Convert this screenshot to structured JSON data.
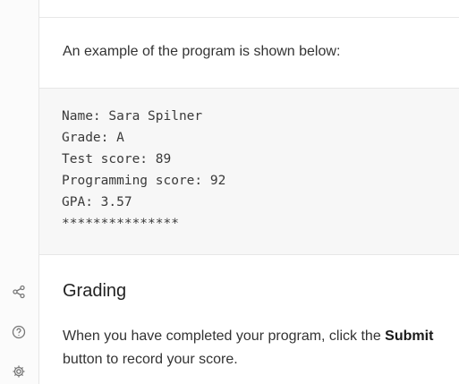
{
  "rail": {
    "icons": [
      {
        "name": "share-icon"
      },
      {
        "name": "help-icon"
      },
      {
        "name": "settings-icon"
      }
    ]
  },
  "intro": {
    "text": "An example of the program is shown below:"
  },
  "code": {
    "lines": [
      "Name: Sara Spilner",
      "Grade: A",
      "Test score: 89",
      "Programming score: 92",
      "GPA: 3.57",
      "***************"
    ]
  },
  "grading": {
    "title": "Grading",
    "text_before": "When you have completed your program, click the ",
    "submit_word": "Submit",
    "text_after": " button to record your score."
  }
}
